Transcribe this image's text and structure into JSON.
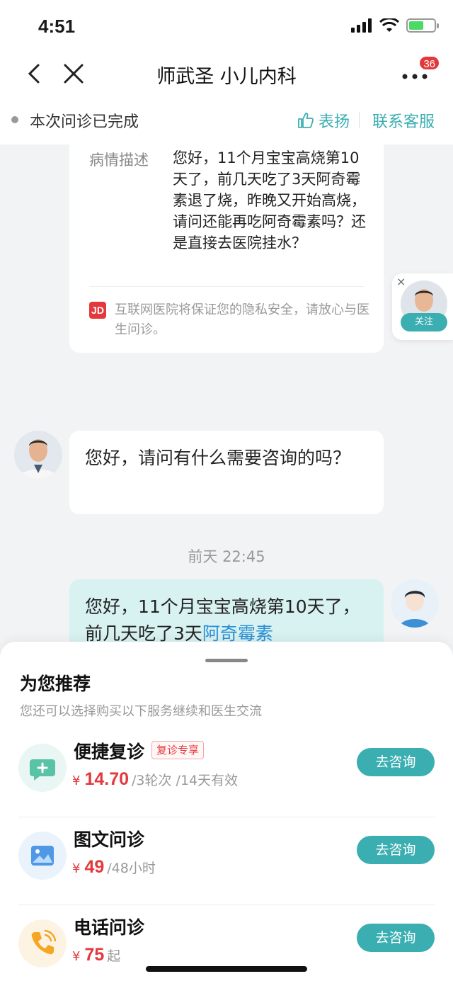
{
  "status_bar": {
    "time": "4:51"
  },
  "nav": {
    "title": "师武圣 小儿内科",
    "badge": "36"
  },
  "consult_status": {
    "text": "本次问诊已完成",
    "praise_label": "表扬",
    "service_label": "联系客服"
  },
  "card": {
    "label": "病情描述",
    "description": "您好，11个月宝宝高烧第10天了，前几天吃了3天阿奇霉素退了烧，昨晚又开始高烧，请问还能再吃阿奇霉素吗？还是直接去医院挂水？",
    "logo_text": "JD",
    "notice": "互联网医院将保证您的隐私安全，请放心与医生问诊。"
  },
  "follow": {
    "close": "×",
    "label": "关注"
  },
  "messages": {
    "doctor_text": "您好，请问有什么需要咨询的吗？",
    "timestamp": "前天 22:45",
    "user_text": "您好，11个月宝宝高烧第10天了，前几天吃了3天",
    "user_link": "阿奇霉素"
  },
  "sheet": {
    "title": "为您推荐",
    "subtitle": "您还可以选择购买以下服务继续和医生交流",
    "services": [
      {
        "name": "便捷复诊",
        "tag": "复诊专享",
        "currency": "¥",
        "price": "14.70",
        "unit": "/3轮次 /14天有效",
        "button": "去咨询",
        "icon": "chat-plus-icon"
      },
      {
        "name": "图文问诊",
        "currency": "¥",
        "price": "49",
        "unit": "/48小时",
        "button": "去咨询",
        "icon": "image-icon"
      },
      {
        "name": "电话问诊",
        "currency": "¥",
        "price": "75",
        "unit": "起",
        "button": "去咨询",
        "icon": "phone-icon"
      }
    ]
  },
  "colors": {
    "accent": "#3aaeb1",
    "price": "#e4393c",
    "user_bubble": "#d8f1f1"
  }
}
